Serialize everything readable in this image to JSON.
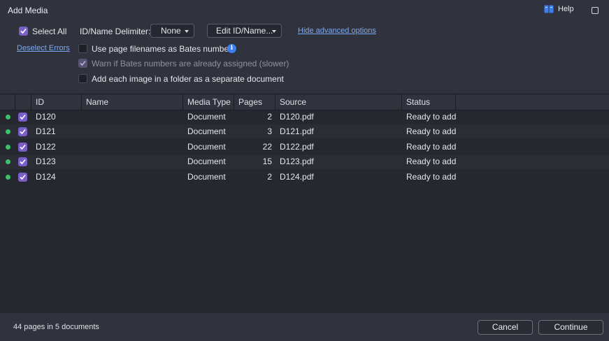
{
  "window": {
    "title": "Add Media",
    "help_label": "Help"
  },
  "options": {
    "select_all_label": "Select All",
    "delimiter_label": "ID/Name Delimiter:",
    "delimiter_value": "None",
    "edit_id_label": "Edit ID/Name...",
    "hide_advanced_label": "Hide advanced options",
    "deselect_errors_label": "Deselect Errors",
    "use_filenames_label": "Use page filenames as Bates numbers",
    "warn_bates_label": "Warn if Bates numbers are already assigned (slower)",
    "each_image_label": "Add each image in a folder as a separate document",
    "info_glyph": "i"
  },
  "table": {
    "columns": [
      "ID",
      "Name",
      "Media Type",
      "Pages",
      "Source",
      "Status"
    ],
    "rows": [
      {
        "id": "D120",
        "name": "",
        "media_type": "Document",
        "pages": "2",
        "source": "D120.pdf",
        "status": "Ready to add"
      },
      {
        "id": "D121",
        "name": "",
        "media_type": "Document",
        "pages": "3",
        "source": "D121.pdf",
        "status": "Ready to add"
      },
      {
        "id": "D122",
        "name": "",
        "media_type": "Document",
        "pages": "22",
        "source": "D122.pdf",
        "status": "Ready to add"
      },
      {
        "id": "D123",
        "name": "",
        "media_type": "Document",
        "pages": "15",
        "source": "D123.pdf",
        "status": "Ready to add"
      },
      {
        "id": "D124",
        "name": "",
        "media_type": "Document",
        "pages": "2",
        "source": "D124.pdf",
        "status": "Ready to add"
      }
    ]
  },
  "footer": {
    "summary": "44 pages in 5 documents",
    "cancel_label": "Cancel",
    "continue_label": "Continue"
  },
  "icons": {
    "help": "book-icon",
    "maximize": "maximize-icon",
    "info": "info-icon",
    "status": "status-dot-icon",
    "check": "checkmark-icon"
  },
  "colors": {
    "accent": "#7a5fc9",
    "link": "#7ea8f0",
    "ok": "#3fc16a",
    "info": "#3d7ff0"
  }
}
